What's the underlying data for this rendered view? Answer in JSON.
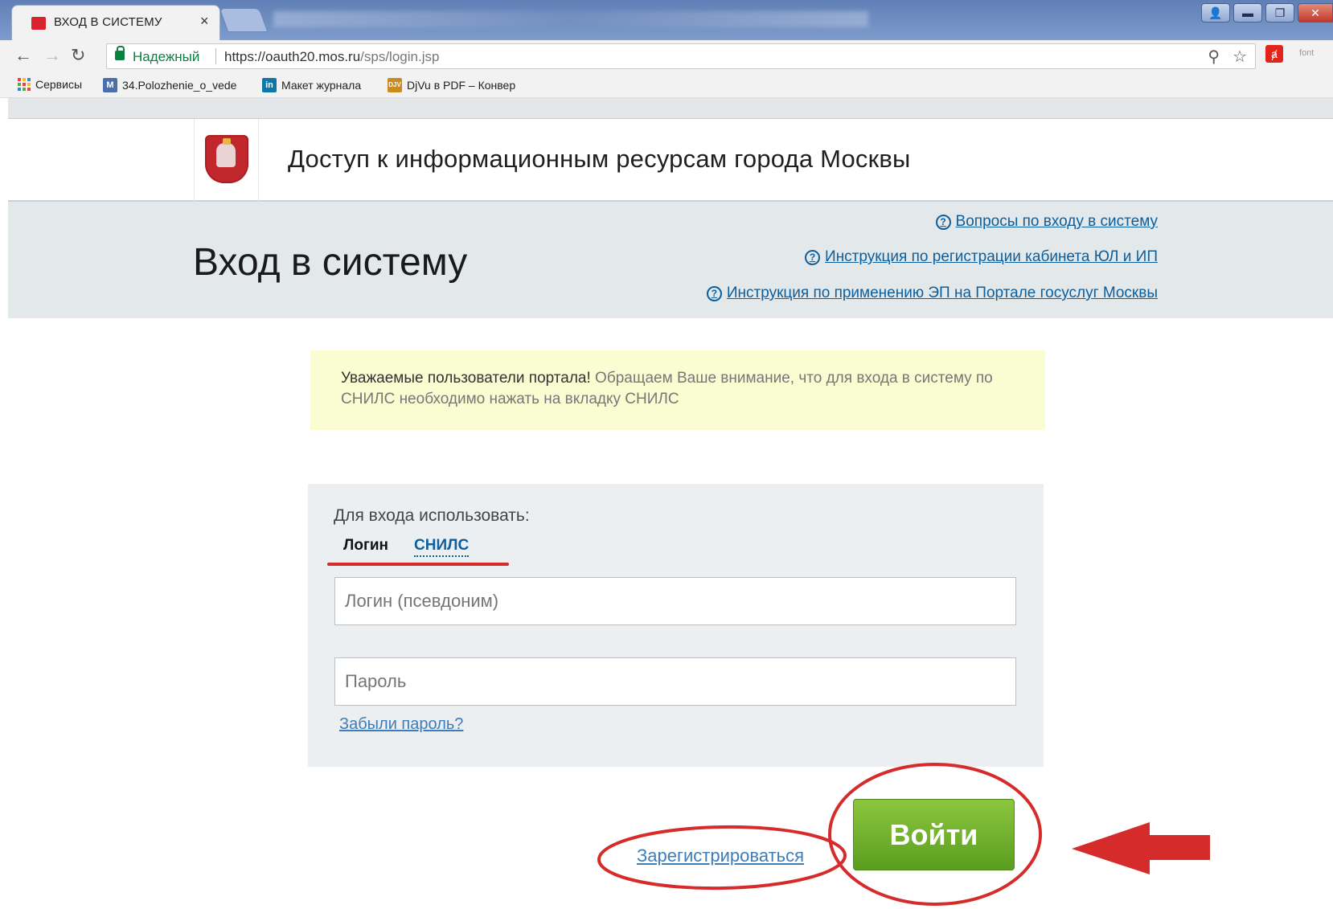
{
  "browser": {
    "tab_title": "ВХОД В СИСТЕМУ",
    "tab_close": "×",
    "secure_label": "Надежный",
    "url_host": "https://oauth20.mos.ru",
    "url_path": "/sps/login.jsp",
    "ext_font_label": "font",
    "window_buttons": [
      "▬",
      "❐",
      "✕"
    ],
    "bookmarks": [
      {
        "label": "Сервисы",
        "icon": "apps-grid-icon"
      },
      {
        "label": "34.Polozhenie_o_vede",
        "icon": "document-icon"
      },
      {
        "label": "Макет журнала",
        "icon": "linkedin-icon"
      },
      {
        "label": "DjVu в PDF – Конвер",
        "icon": "djvu-icon"
      }
    ]
  },
  "header": {
    "site_title": "Доступ к информационным ресурсам города Москвы"
  },
  "band": {
    "page_title": "Вход в систему",
    "help_links": [
      "Вопросы по входу в систему",
      "Инструкция по регистрации кабинета ЮЛ и ИП",
      "Инструкция по применению ЭП на Портале госуслуг Москвы"
    ]
  },
  "notice": {
    "bold": "Уважаемые пользователи портала!",
    "text": " Обращаем Ваше внимание, что для входа в систему по СНИЛС необходимо нажать на вкладку СНИЛС"
  },
  "login": {
    "use_label": "Для входа использовать:",
    "tab_login": "Логин",
    "tab_snils": "СНИЛС",
    "login_placeholder": "Логин (псевдоним)",
    "login_value": "",
    "password_placeholder": "Пароль",
    "password_value": "",
    "forgot_link": "Забыли пароль?"
  },
  "actions": {
    "register_link": "Зарегистрироваться",
    "enter_button": "Войти"
  },
  "colors": {
    "accent_green": "#6aae2a",
    "link_blue": "#0d5e9c",
    "annotation_red": "#d62b2b"
  }
}
